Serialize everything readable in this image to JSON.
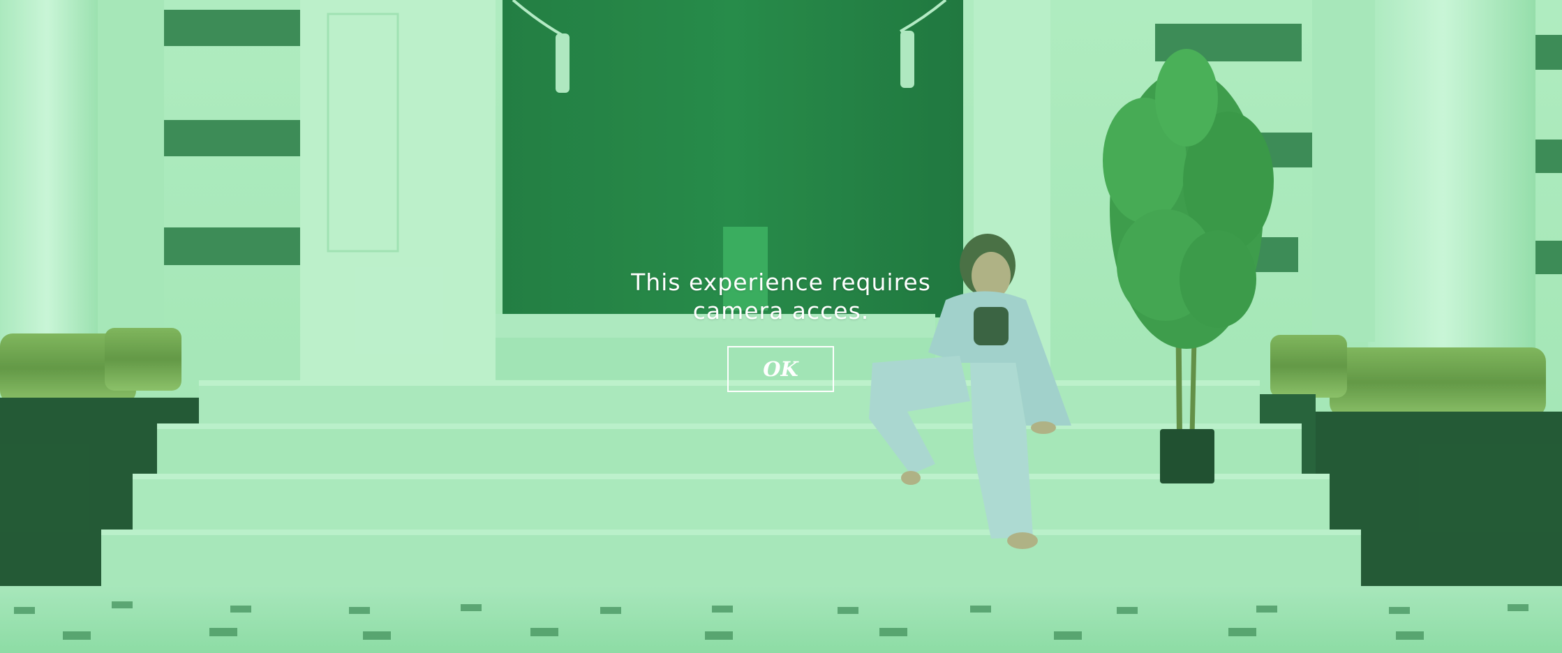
{
  "background": {
    "tint_color": "#6ee08f",
    "scene": "background-photo"
  },
  "dialog": {
    "message_line1": "This experience requires",
    "message_line2": "camera acces.",
    "ok_label": "OK",
    "text_color": "#ffffff"
  }
}
